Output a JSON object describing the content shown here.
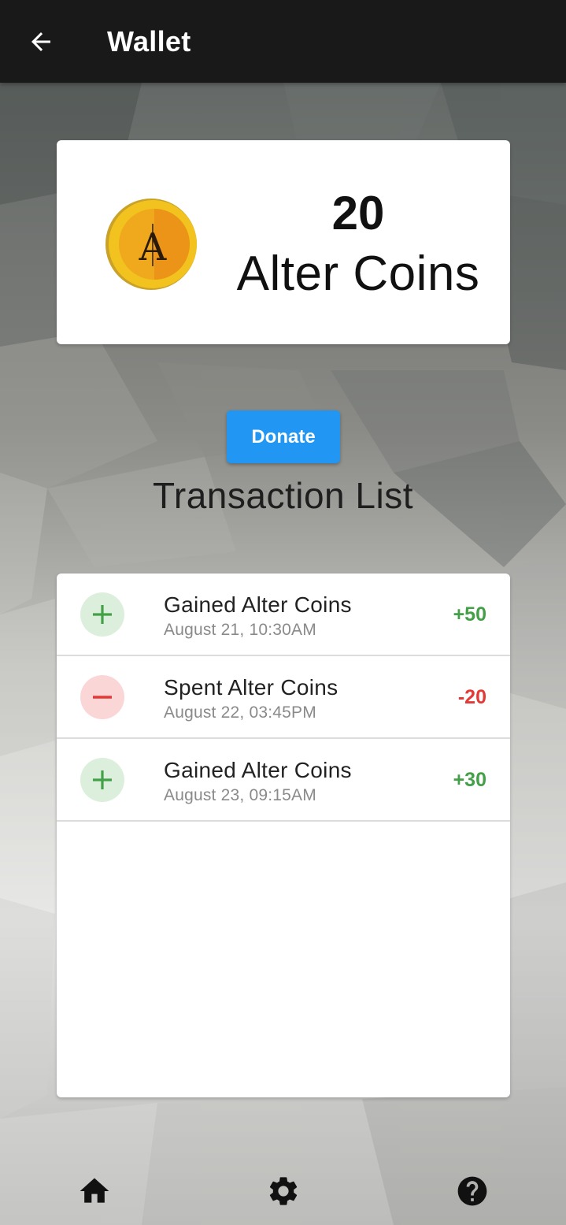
{
  "appbar": {
    "title": "Wallet",
    "back_icon": "arrow-back-icon"
  },
  "balance": {
    "amount": "20",
    "unit": "Alter Coins",
    "coin_icon": "alter-coin-icon",
    "coin_letter": "A"
  },
  "donate_button": "Donate",
  "transactions_title": "Transaction List",
  "transactions": [
    {
      "type": "gain",
      "icon": "plus-icon",
      "title": "Gained Alter Coins",
      "date": "August 21, 10:30AM",
      "amount": "+50"
    },
    {
      "type": "spend",
      "icon": "minus-icon",
      "title": "Spent Alter Coins",
      "date": "August 22, 03:45PM",
      "amount": "-20"
    },
    {
      "type": "gain",
      "icon": "plus-icon",
      "title": "Gained Alter Coins",
      "date": "August 23, 09:15AM",
      "amount": "+30"
    }
  ],
  "bottom_nav": [
    "home-icon",
    "settings-gear-icon",
    "help-icon"
  ],
  "colors": {
    "appbar": "#191919",
    "primary": "#2196f3",
    "gain": "#43a047",
    "spend": "#e53935"
  }
}
